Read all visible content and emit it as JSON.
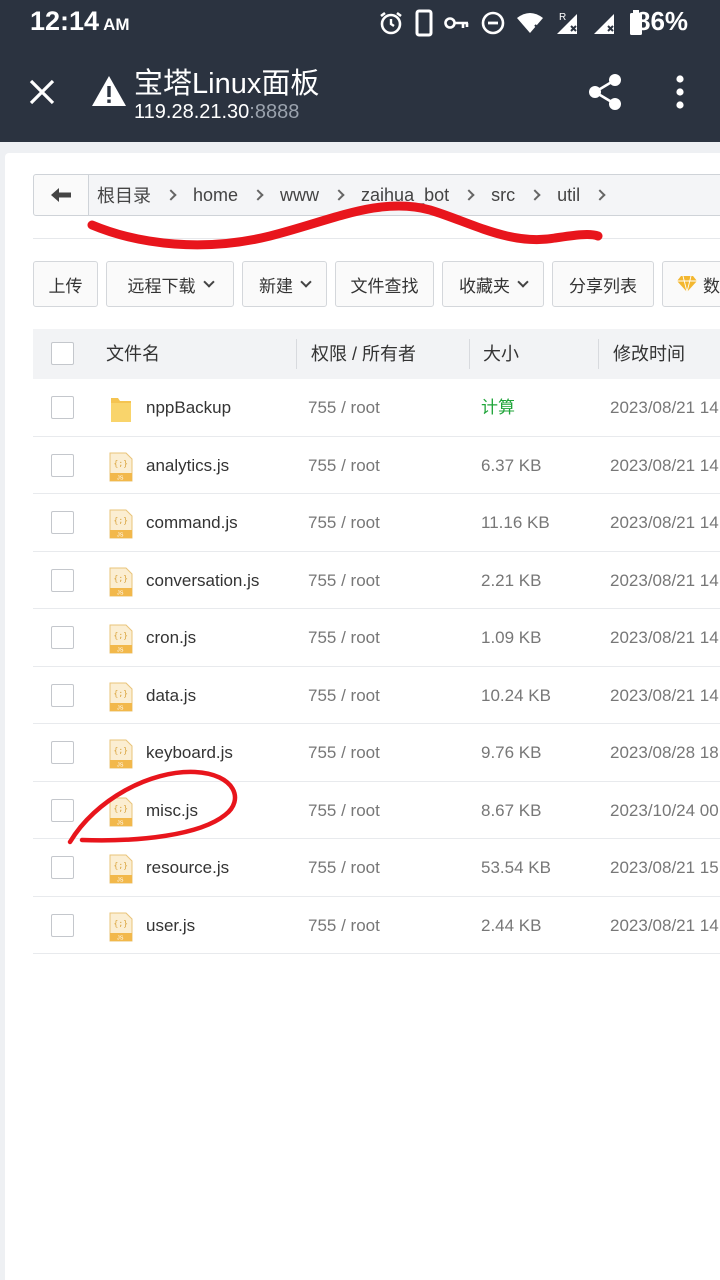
{
  "status_bar": {
    "time": "12:14",
    "ampm": "AM",
    "battery": "86%",
    "icons": [
      "alarm-icon",
      "phone-icon",
      "vpn-key-icon",
      "dnd-icon",
      "wifi-icon",
      "signal-roaming-icon",
      "signal-icon",
      "battery-icon"
    ]
  },
  "toolbar": {
    "title": "宝塔Linux面板",
    "url_host": "119.28.21.30",
    "url_port": ":8888",
    "icons": [
      "close-icon",
      "warning-icon",
      "share-icon",
      "more-vert-icon"
    ]
  },
  "breadcrumb": {
    "segments": [
      "根目录",
      "home",
      "www",
      "zaihua_bot",
      "src",
      "util"
    ]
  },
  "buttons": [
    {
      "label": "上传",
      "dropdown": false
    },
    {
      "label": "远程下载",
      "dropdown": true
    },
    {
      "label": "新建",
      "dropdown": true
    },
    {
      "label": "文件查找",
      "dropdown": false
    },
    {
      "label": "收藏夹",
      "dropdown": true
    },
    {
      "label": "分享列表",
      "dropdown": false
    },
    {
      "label": "数据",
      "dropdown": false,
      "icon": "diamond-icon"
    }
  ],
  "table": {
    "headers": {
      "name": "文件名",
      "perm": "权限 / 所有者",
      "size": "大小",
      "mtime": "修改时间"
    },
    "rows": [
      {
        "name": "nppBackup",
        "type": "folder",
        "perm": "755 / root",
        "size": "计算",
        "mtime": "2023/08/21 14"
      },
      {
        "name": "analytics.js",
        "type": "js",
        "perm": "755 / root",
        "size": "6.37 KB",
        "mtime": "2023/08/21 14"
      },
      {
        "name": "command.js",
        "type": "js",
        "perm": "755 / root",
        "size": "11.16 KB",
        "mtime": "2023/08/21 14"
      },
      {
        "name": "conversation.js",
        "type": "js",
        "perm": "755 / root",
        "size": "2.21 KB",
        "mtime": "2023/08/21 14"
      },
      {
        "name": "cron.js",
        "type": "js",
        "perm": "755 / root",
        "size": "1.09 KB",
        "mtime": "2023/08/21 14"
      },
      {
        "name": "data.js",
        "type": "js",
        "perm": "755 / root",
        "size": "10.24 KB",
        "mtime": "2023/08/21 14"
      },
      {
        "name": "keyboard.js",
        "type": "js",
        "perm": "755 / root",
        "size": "9.76 KB",
        "mtime": "2023/08/28 18"
      },
      {
        "name": "misc.js",
        "type": "js",
        "perm": "755 / root",
        "size": "8.67 KB",
        "mtime": "2023/10/24 00"
      },
      {
        "name": "resource.js",
        "type": "js",
        "perm": "755 / root",
        "size": "53.54 KB",
        "mtime": "2023/08/21 15"
      },
      {
        "name": "user.js",
        "type": "js",
        "perm": "755 / root",
        "size": "2.44 KB",
        "mtime": "2023/08/21 14"
      }
    ]
  },
  "colors": {
    "header_bg": "#2b3340",
    "calc_green": "#20a53a",
    "annotation_red": "#e8151c",
    "js_icon_gold": "#f2b84b"
  }
}
